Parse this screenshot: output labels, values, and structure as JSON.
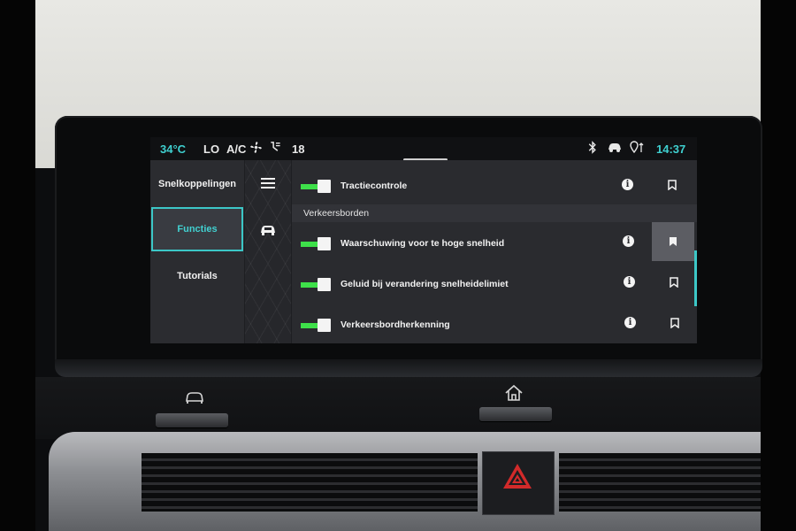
{
  "status": {
    "temperature": "34°C",
    "fan": "LO",
    "ac": "A/C",
    "setpoint": "18",
    "time": "14:37"
  },
  "menu": {
    "items": [
      {
        "label": "Snelkoppelingen"
      },
      {
        "label": "Functies"
      },
      {
        "label": "Tutorials"
      }
    ],
    "active_index": 1
  },
  "content": {
    "rows_top": [
      {
        "label": "Tractiecontrole",
        "enabled": true
      }
    ],
    "section": "Verkeersborden",
    "rows": [
      {
        "label": "Waarschuwing voor te hoge snelheid",
        "enabled": true,
        "bookmarked": true
      },
      {
        "label": "Geluid bij verandering snelheidelimiet",
        "enabled": true,
        "bookmarked": false
      },
      {
        "label": "Verkeersbordherkenning",
        "enabled": true,
        "bookmarked": false
      }
    ]
  },
  "icons": {
    "statusbar": [
      "fan-icon",
      "air-flow-icon",
      "bluetooth-icon",
      "car-connect-icon",
      "location-icon"
    ],
    "sidebar": [
      "menu-icon",
      "car-icon"
    ],
    "row_actions": [
      "info-icon",
      "bookmark-icon"
    ],
    "hardware": [
      "car-button-icon",
      "home-button-icon",
      "hazard-icon"
    ]
  },
  "colors": {
    "accent_cyan": "#3cc7c7",
    "toggle_on": "#3ee04a",
    "hazard_red": "#d22a2a"
  }
}
